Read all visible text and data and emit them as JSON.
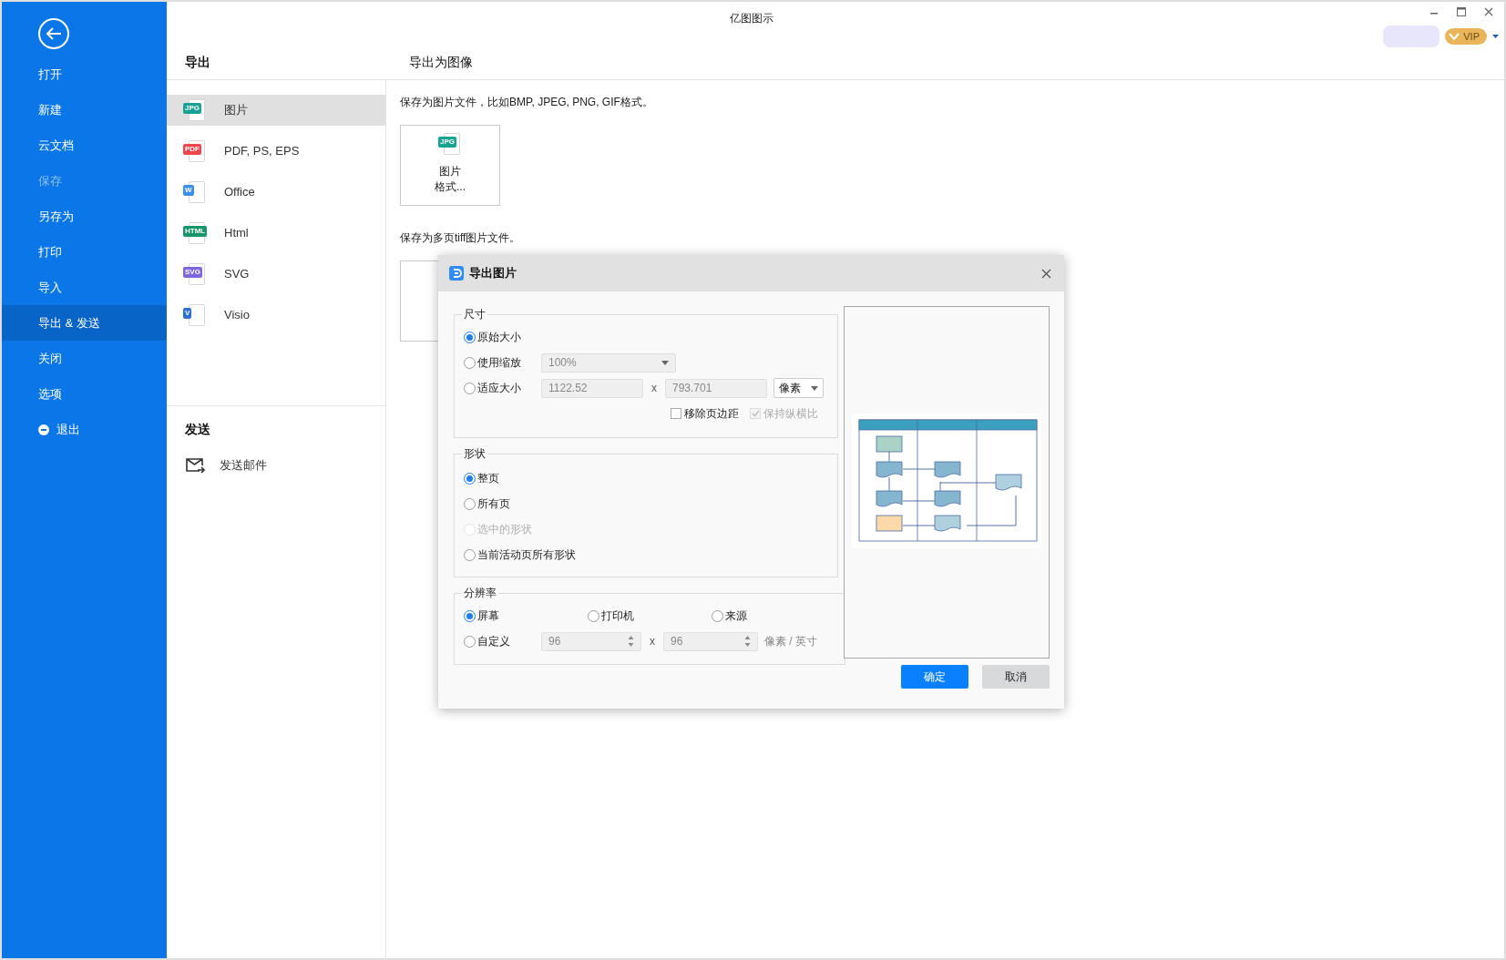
{
  "window": {
    "title": "亿图图示",
    "vip": "VIP"
  },
  "sidebar": {
    "items": [
      {
        "label": "打开",
        "kind": "item",
        "selected": false,
        "disabled": false
      },
      {
        "label": "新建",
        "kind": "item",
        "selected": false,
        "disabled": false
      },
      {
        "label": "云文档",
        "kind": "item",
        "selected": false,
        "disabled": false
      },
      {
        "label": "保存",
        "kind": "item",
        "selected": false,
        "disabled": true
      },
      {
        "label": "另存为",
        "kind": "item",
        "selected": false,
        "disabled": false
      },
      {
        "label": "打印",
        "kind": "item",
        "selected": false,
        "disabled": false
      },
      {
        "label": "导入",
        "kind": "item",
        "selected": false,
        "disabled": false
      },
      {
        "label": "导出 & 发送",
        "kind": "item",
        "selected": true,
        "disabled": false
      },
      {
        "label": "关闭",
        "kind": "item",
        "selected": false,
        "disabled": false
      },
      {
        "label": "选项",
        "kind": "item",
        "selected": false,
        "disabled": false
      },
      {
        "label": "退出",
        "kind": "exit",
        "selected": false,
        "disabled": false
      }
    ]
  },
  "export_panel": {
    "heading": "导出",
    "items": [
      {
        "label": "图片",
        "badge": "JPG",
        "color": "#16a393",
        "selected": true
      },
      {
        "label": "PDF, PS, EPS",
        "badge": "PDF",
        "color": "#f0454a",
        "selected": false
      },
      {
        "label": "Office",
        "badge": "W",
        "color": "#3a8ef0",
        "selected": false
      },
      {
        "label": "Html",
        "badge": "HTML",
        "color": "#17966a",
        "selected": false
      },
      {
        "label": "SVG",
        "badge": "SVG",
        "color": "#7e66e0",
        "selected": false
      },
      {
        "label": "Visio",
        "badge": "V",
        "color": "#2b6fd6",
        "selected": false
      }
    ]
  },
  "send_panel": {
    "heading": "发送",
    "items": [
      {
        "label": "发送邮件"
      }
    ]
  },
  "content": {
    "heading": "导出为图像",
    "sections": [
      {
        "description": "保存为图片文件，比如BMP, JPEG, PNG, GIF格式。",
        "card": {
          "badge": "JPG",
          "color": "#16a393",
          "lines": [
            "图片",
            "格式..."
          ]
        }
      },
      {
        "description": "保存为多页tiff图片文件。"
      }
    ]
  },
  "dialog": {
    "title": "导出图片",
    "size_group": {
      "legend": "尺寸",
      "options": [
        {
          "label": "原始大小",
          "selected": true
        },
        {
          "label": "使用缩放",
          "selected": false
        },
        {
          "label": "适应大小",
          "selected": false
        }
      ],
      "scale": {
        "value": "100%",
        "disabled": true
      },
      "width": {
        "value": "1122.52",
        "disabled": true
      },
      "times": "x",
      "height": {
        "value": "793.701",
        "disabled": true
      },
      "unit": {
        "value": "像素"
      },
      "checkboxes": [
        {
          "label": "移除页边距",
          "checked": false,
          "disabled": false
        },
        {
          "label": "保持纵横比",
          "checked": true,
          "disabled": true
        }
      ]
    },
    "shape_group": {
      "legend": "形状",
      "options": [
        {
          "label": "整页",
          "selected": true,
          "disabled": false
        },
        {
          "label": "所有页",
          "selected": false,
          "disabled": false
        },
        {
          "label": "选中的形状",
          "selected": false,
          "disabled": true
        },
        {
          "label": "当前活动页所有形状",
          "selected": false,
          "disabled": false
        }
      ]
    },
    "resolution_group": {
      "legend": "分辨率",
      "options": [
        {
          "label": "屏幕",
          "selected": true
        },
        {
          "label": "打印机",
          "selected": false
        },
        {
          "label": "来源",
          "selected": false
        },
        {
          "label": "自定义",
          "selected": false
        }
      ],
      "fields": [
        {
          "value": "96",
          "disabled": true
        },
        {
          "value": "96",
          "disabled": true
        }
      ],
      "times": "x",
      "unit": "像素 / 英寸"
    },
    "buttons": [
      {
        "label": "确定",
        "kind": "primary"
      },
      {
        "label": "取消",
        "kind": "secondary"
      }
    ]
  }
}
